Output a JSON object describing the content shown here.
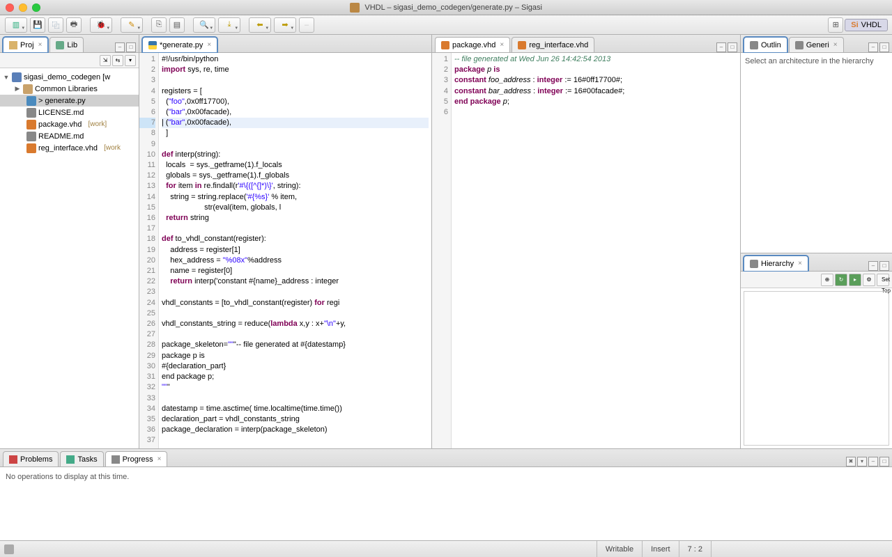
{
  "window": {
    "title": "VHDL – sigasi_demo_codegen/generate.py – Sigasi"
  },
  "perspective": {
    "label": "VHDL"
  },
  "left_tabs": {
    "proj": "Proj",
    "lib": "Lib"
  },
  "project_tree": {
    "root": "sigasi_demo_codegen [w",
    "common": "Common Libraries",
    "file1": "> generate.py",
    "file2": "LICENSE.md",
    "file3": "package.vhd",
    "file3_deco": "[work]",
    "file4": "README.md",
    "file5": "reg_interface.vhd",
    "file5_deco": "[work"
  },
  "editor_tabs": {
    "py": "*generate.py",
    "pkg": "package.vhd",
    "reg": "reg_interface.vhd"
  },
  "py_code": {
    "lines": [
      "#!/usr/bin/python",
      "import sys, re, time",
      "",
      "registers = [",
      "  (\"foo\",0x0ff17700),",
      "  (\"bar\",0x00facade),",
      "| (\"bar\",0x00facade),",
      "  ]",
      "",
      "def interp(string):",
      "  locals  = sys._getframe(1).f_locals",
      "  globals = sys._getframe(1).f_globals",
      "  for item in re.findall(r'#\\{([^{]*)\\}', string):",
      "    string = string.replace('#{%s}' % item,",
      "                    str(eval(item, globals, l",
      "  return string",
      "",
      "def to_vhdl_constant(register):",
      "    address = register[1]",
      "    hex_address = \"%08x\"%address",
      "    name = register[0]",
      "    return interp('constant #{name}_address : integer",
      "",
      "vhdl_constants = [to_vhdl_constant(register) for regi",
      "",
      "vhdl_constants_string = reduce(lambda x,y : x+\"\\n\"+y,",
      "",
      "package_skeleton=\"\"\"-- file generated at #{datestamp}",
      "package p is",
      "#{declaration_part}",
      "end package p;",
      "\"\"\"",
      "",
      "datestamp = time.asctime( time.localtime(time.time())",
      "declaration_part = vhdl_constants_string",
      "package_declaration = interp(package_skeleton)"
    ]
  },
  "vhd_code": {
    "lines": [
      {
        "t": "-- file generated at Wed Jun 26 14:42:54 2013",
        "cls": "vhdlcmt"
      },
      {
        "t": "package p is"
      },
      {
        "t": "constant foo_address : integer := 16#0ff17700#;"
      },
      {
        "t": "constant bar_address : integer := 16#00facade#;"
      },
      {
        "t": "end package p;"
      },
      {
        "t": ""
      }
    ]
  },
  "right": {
    "outline_tab": "Outlin",
    "generi_tab": "Generi",
    "outline_msg": "Select an architecture in the hierarchy",
    "hierarchy_tab": "Hierarchy",
    "settop": "Set Top"
  },
  "bottom": {
    "problems": "Problems",
    "tasks": "Tasks",
    "progress": "Progress",
    "msg": "No operations to display at this time."
  },
  "status": {
    "writable": "Writable",
    "insert": "Insert",
    "pos": "7 : 2"
  }
}
